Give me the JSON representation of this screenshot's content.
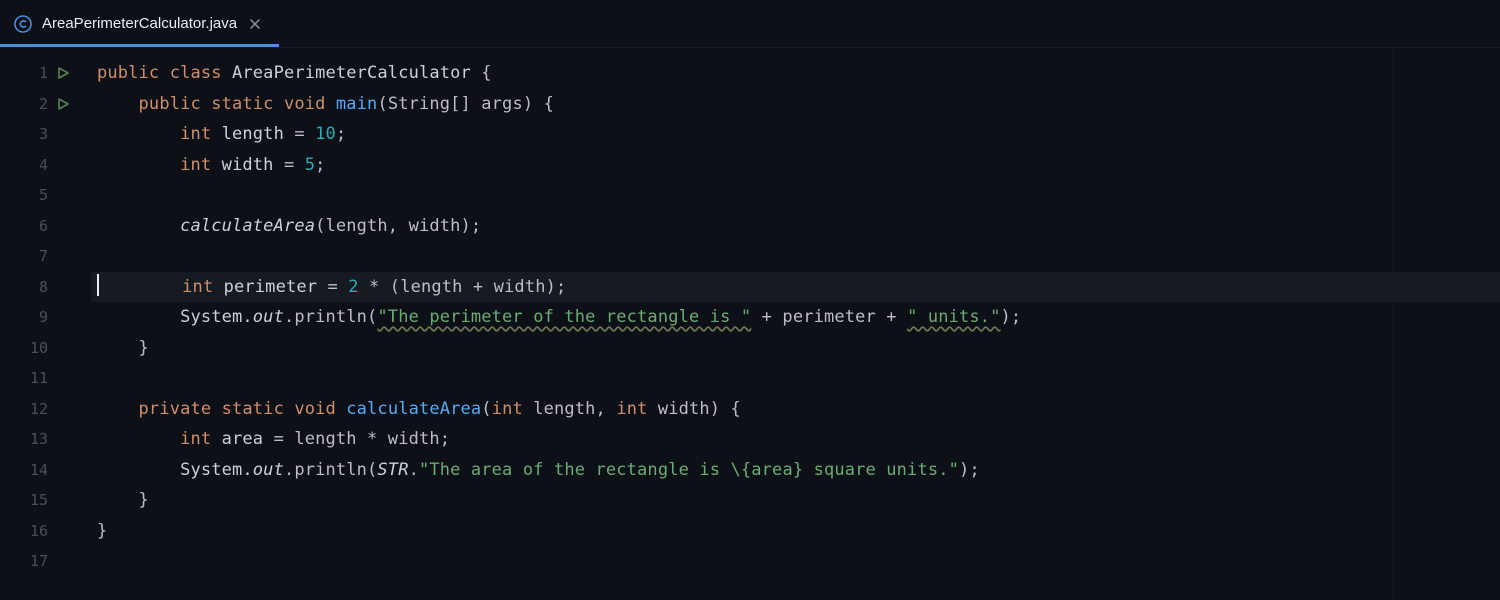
{
  "tab": {
    "filename": "AreaPerimeterCalculator.java",
    "icon": "class-circle-icon",
    "active": true
  },
  "editor": {
    "active_line": 8,
    "lines": [
      {
        "n": 1,
        "run": true
      },
      {
        "n": 2,
        "run": true
      },
      {
        "n": 3
      },
      {
        "n": 4
      },
      {
        "n": 5
      },
      {
        "n": 6
      },
      {
        "n": 7
      },
      {
        "n": 8
      },
      {
        "n": 9
      },
      {
        "n": 10
      },
      {
        "n": 11
      },
      {
        "n": 12
      },
      {
        "n": 13
      },
      {
        "n": 14
      },
      {
        "n": 15
      },
      {
        "n": 16
      },
      {
        "n": 17
      }
    ]
  },
  "code": {
    "l1": {
      "kw1": "public",
      "kw2": "class",
      "cls": "AreaPerimeterCalculator",
      "brace": "{"
    },
    "l2": {
      "kw1": "public",
      "kw2": "static",
      "kw3": "void",
      "fn": "main",
      "args": "(String[] args) {"
    },
    "l3": {
      "kw": "int",
      "id": "length",
      "eq": " = ",
      "num": "10",
      "semi": ";"
    },
    "l4": {
      "kw": "int",
      "id": "width",
      "eq": " = ",
      "num": "5",
      "semi": ";"
    },
    "l6": {
      "fn": "calculateArea",
      "args": "(length, width);"
    },
    "l8": {
      "kw": "int",
      "id": "perimeter",
      "eq": " = ",
      "num": "2",
      "rest": " * (length + width);"
    },
    "l9": {
      "sys": "System.",
      "out": "out",
      "pr": ".println(",
      "s1": "\"The perimeter of the rectangle is \"",
      "plus1": " + perimeter + ",
      "s2": "\" units.\"",
      "end": ");"
    },
    "l10": {
      "brace": "}"
    },
    "l12": {
      "kw1": "private",
      "kw2": "static",
      "kw3": "void",
      "fn": "calculateArea",
      "args": "(",
      "kw4": "int",
      "p1": " length, ",
      "kw5": "int",
      "p2": " width) {"
    },
    "l13": {
      "kw": "int",
      "id": "area",
      "rest": " = length * width;"
    },
    "l14": {
      "sys": "System.",
      "out": "out",
      "pr": ".println(",
      "str": "STR",
      "dot": ".",
      "s": "\"The area of the rectangle is \\{area} square units.\"",
      "end": ");"
    },
    "l15": {
      "brace": "}"
    },
    "l16": {
      "brace": "}"
    }
  }
}
